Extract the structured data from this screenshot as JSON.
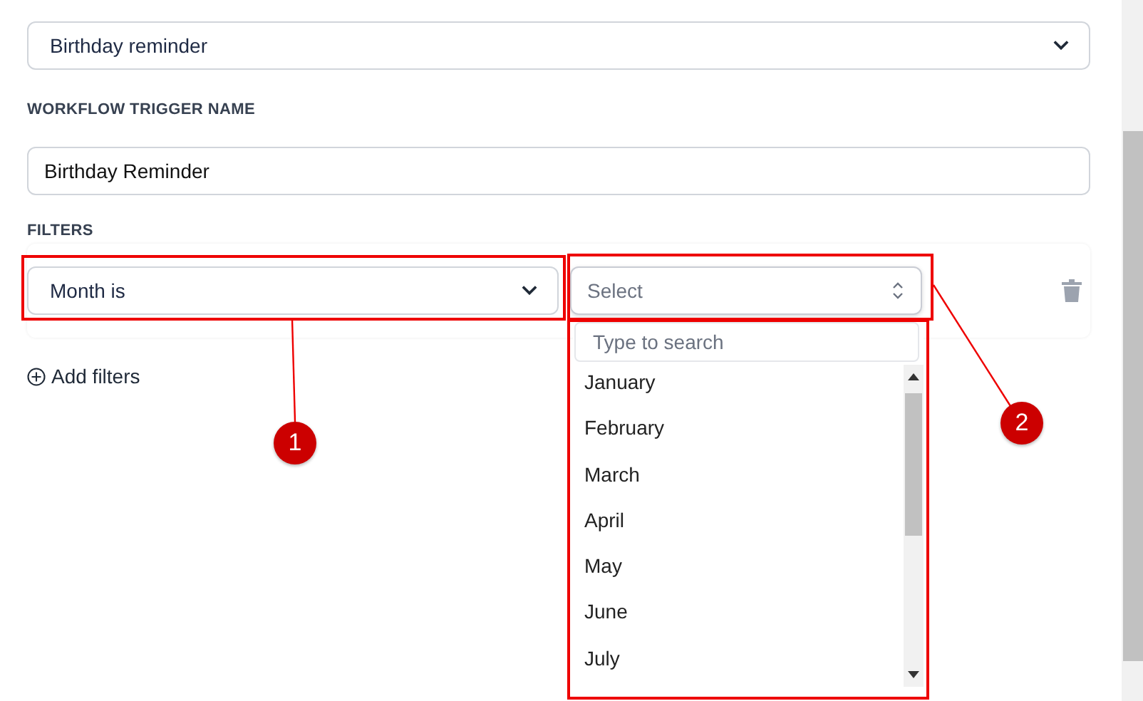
{
  "trigger_select": {
    "value": "Birthday reminder"
  },
  "trigger_name": {
    "label": "WORKFLOW TRIGGER NAME",
    "value": "Birthday Reminder"
  },
  "filters": {
    "label": "FILTERS",
    "condition": {
      "value": "Month is"
    },
    "value_select": {
      "placeholder": "Select",
      "expanded": true
    },
    "add_label": "Add filters"
  },
  "dropdown": {
    "search_placeholder": "Type to search",
    "options": [
      "January",
      "February",
      "March",
      "April",
      "May",
      "June",
      "July"
    ]
  },
  "callouts": [
    {
      "number": "1"
    },
    {
      "number": "2"
    }
  ]
}
